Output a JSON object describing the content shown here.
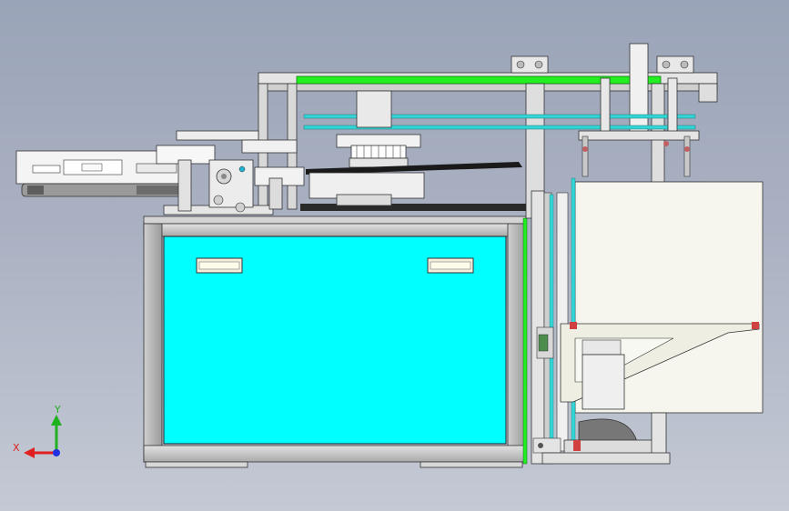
{
  "viewport": {
    "background_top": "#9aa4b8",
    "background_bottom": "#c4c9d4"
  },
  "triad": {
    "x_label": "X",
    "y_label": "Y",
    "x_color": "#e02020",
    "y_color": "#20b020",
    "z_color": "#2030e0"
  },
  "colors": {
    "panel_cyan": "#00ffff",
    "rail_green": "#22ee22",
    "rod_cyan": "#33d6d6",
    "frame_grey": "#cfcfcf",
    "frame_dark": "#8c8c8c",
    "hopper_cream": "#f7f6ee"
  }
}
